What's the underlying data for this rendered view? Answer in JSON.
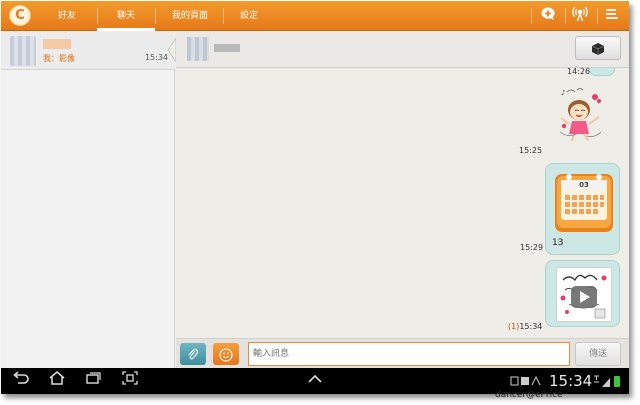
{
  "app": {
    "logo_glyph": "C",
    "accent": "#e8821f"
  },
  "tabs": [
    {
      "label": "好友",
      "active": false
    },
    {
      "label": "聊天",
      "active": true
    },
    {
      "label": "我的頁面",
      "active": false
    },
    {
      "label": "設定",
      "active": false
    }
  ],
  "top_icons": {
    "add": "add-chat-icon",
    "signal": "broadcast-icon",
    "menu": "menu-icon"
  },
  "conversation": {
    "preview": "我：影像",
    "time": "15:34"
  },
  "chat_header": {
    "button_icon": "box-icon"
  },
  "messages": [
    {
      "kind": "partial",
      "time": "14:26"
    },
    {
      "kind": "sticker",
      "sticker": "dancing-girl-sticker",
      "time": "15:25"
    },
    {
      "kind": "calendar",
      "calendar_day": "03",
      "text": "13",
      "time": "15:29"
    },
    {
      "kind": "video",
      "read_count": "(1)",
      "time": "15:34"
    }
  ],
  "input": {
    "placeholder": "輸入訊息",
    "send_label": "傳送"
  },
  "system": {
    "clock": "15:34",
    "battery_color": "#39c639"
  },
  "watermark": "dancer@ePrice"
}
